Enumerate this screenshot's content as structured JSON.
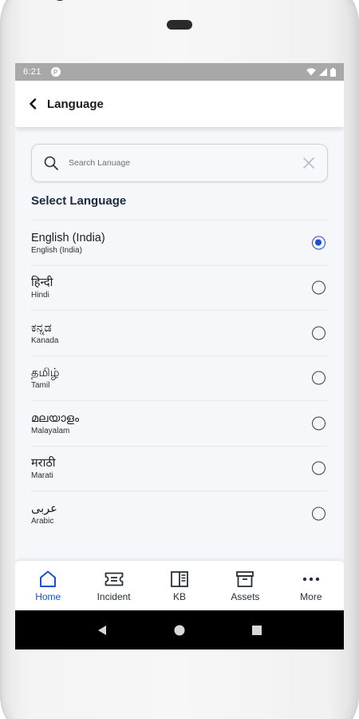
{
  "status": {
    "time": "6:21"
  },
  "appbar": {
    "title": "Language"
  },
  "search": {
    "placeholder": "Search Lanuage"
  },
  "section": {
    "title": "Select Language"
  },
  "languages": [
    {
      "native": "English (India)",
      "latin": "English (India)",
      "selected": true
    },
    {
      "native": "हिन्दी",
      "latin": "Hindi",
      "selected": false
    },
    {
      "native": "ಕನ್ನಡ",
      "latin": "Kanada",
      "selected": false
    },
    {
      "native": "தமிழ்",
      "latin": "Tamil",
      "selected": false
    },
    {
      "native": "മലയാളം",
      "latin": "Malayalam",
      "selected": false
    },
    {
      "native": "मराठी",
      "latin": "Marati",
      "selected": false
    },
    {
      "native": "عربى",
      "latin": "Arabic",
      "selected": false
    }
  ],
  "nav": [
    {
      "label": "Home",
      "icon": "home-icon",
      "active": true
    },
    {
      "label": "Incident",
      "icon": "ticket-icon",
      "active": false
    },
    {
      "label": "KB",
      "icon": "book-icon",
      "active": false
    },
    {
      "label": "Assets",
      "icon": "archive-box-icon",
      "active": false
    },
    {
      "label": "More",
      "icon": "more-dots-icon",
      "active": false
    }
  ],
  "colors": {
    "accent": "#1b4fd8",
    "screen_bg": "#f6f7fb",
    "status_bar": "#a8a8a8"
  }
}
